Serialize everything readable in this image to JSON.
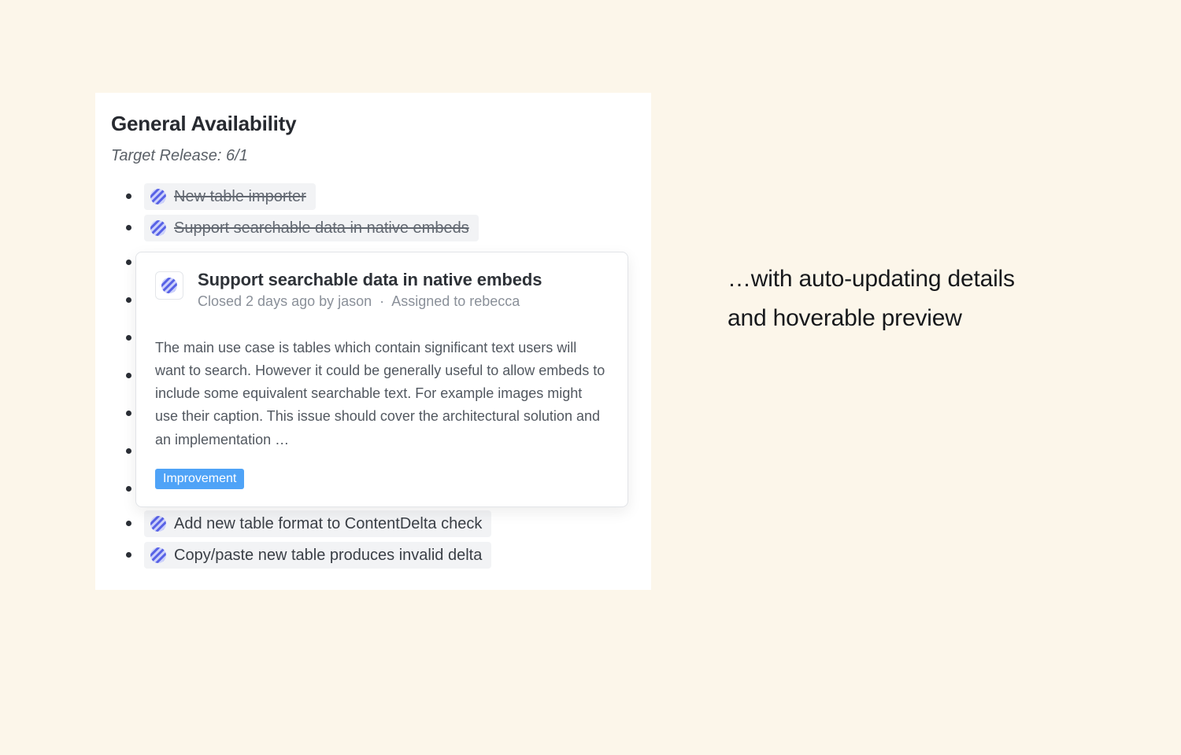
{
  "card": {
    "title": "General Availability",
    "subtitle": "Target Release: 6/1"
  },
  "issues": [
    {
      "label": "New table importer",
      "done": true
    },
    {
      "label": "Support searchable data in native embeds",
      "done": true
    },
    {
      "label": "Add new table format to ContentDelta check",
      "done": false
    },
    {
      "label": "Copy/paste new table produces invalid delta",
      "done": false
    }
  ],
  "hover_bullet_count": 7,
  "popover": {
    "title": "Support searchable data in native embeds",
    "meta_closed": "Closed 2 days ago by jason",
    "meta_sep": "·",
    "meta_assigned": "Assigned to rebecca",
    "body": "The main use case is tables which contain significant text users will want to search. However it could be generally useful to allow embeds to include some equivalent searchable text. For example images might use their caption. This issue should cover the architectural solution and an implementation …",
    "tag": "Improvement"
  },
  "caption": "…with auto-updating details and hoverable preview"
}
